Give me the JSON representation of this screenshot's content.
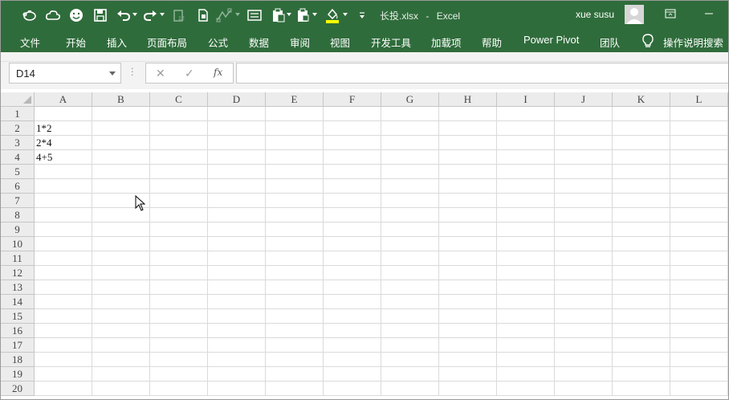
{
  "title_bar": {
    "file_name": "长投.xlsx",
    "separator": "-",
    "app_name": "Excel",
    "user_name": "xue susu",
    "icons": [
      "piggy-bank-icon",
      "cloud-icon",
      "smiley-icon",
      "save-icon",
      "undo-icon",
      "redo-icon",
      "paste-values-icon",
      "paste-format-icon",
      "shapes-icon",
      "form-icon",
      "paste-special-icon",
      "clipboard-icon",
      "fill-color-icon",
      "customize-qat-icon",
      "ribbon-display-icon"
    ],
    "fill_accent_color": "#ffff00",
    "bar_color": "#2f6c3b"
  },
  "ribbon_tabs": [
    "文件",
    "开始",
    "插入",
    "页面布局",
    "公式",
    "数据",
    "审阅",
    "视图",
    "开发工具",
    "加载项",
    "帮助",
    "Power Pivot",
    "团队"
  ],
  "tell_me": {
    "icon": "lightbulb-icon",
    "label": "操作说明搜索"
  },
  "formula_bar": {
    "name_box_value": "D14",
    "cancel_icon": "✕",
    "enter_icon": "✓",
    "fx_label": "fx",
    "formula_value": ""
  },
  "sheet": {
    "columns": [
      "A",
      "B",
      "C",
      "D",
      "E",
      "F",
      "G",
      "H",
      "I",
      "J",
      "K",
      "L"
    ],
    "rows": [
      "1",
      "2",
      "3",
      "4",
      "5",
      "6",
      "7",
      "8",
      "9",
      "10",
      "11",
      "12",
      "13",
      "14",
      "15",
      "16",
      "17",
      "18",
      "19",
      "20"
    ],
    "cells": {
      "A2": "1*2",
      "A3": "2*4",
      "A4": "4+5"
    },
    "gridline_color": "#dadada",
    "header_bg": "#ececec"
  }
}
